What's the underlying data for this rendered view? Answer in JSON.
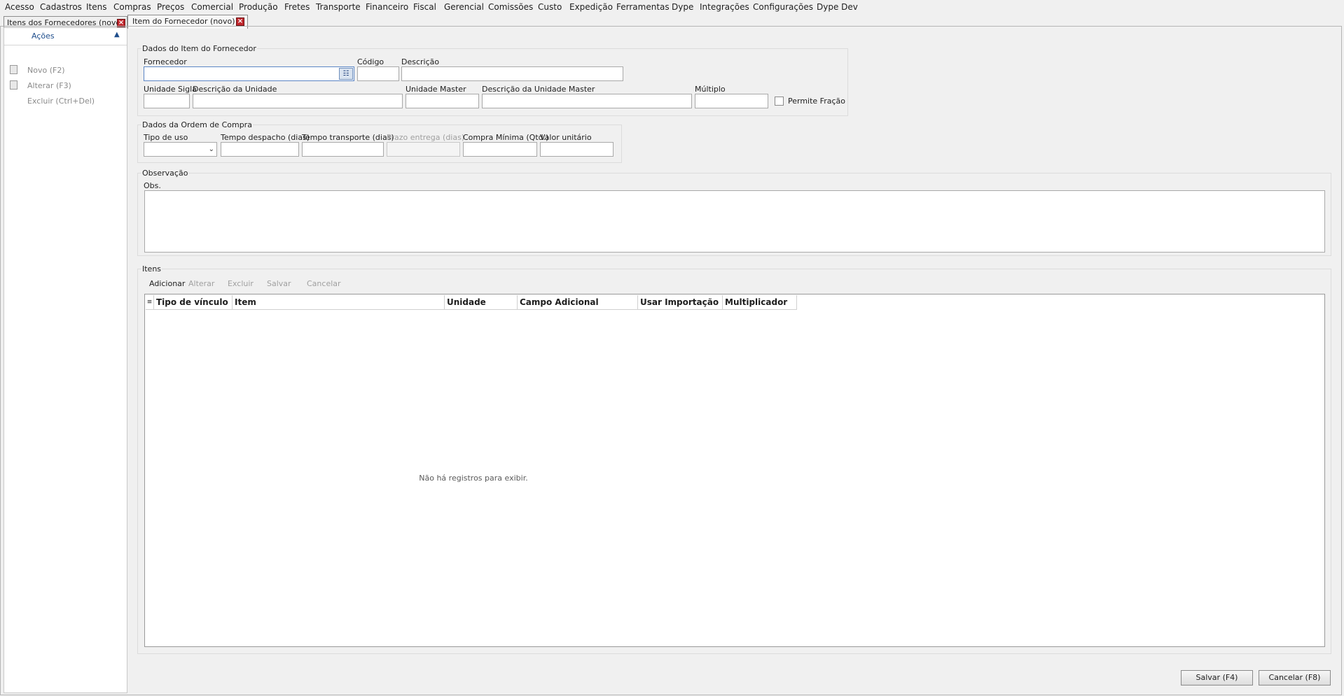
{
  "menu": [
    "Acesso",
    "Cadastros",
    "Itens",
    "Compras",
    "Preços",
    "Comercial",
    "Produção",
    "Fretes",
    "Transporte",
    "Financeiro",
    "Fiscal",
    "Gerencial",
    "Comissões",
    "Custo",
    "Expedição",
    "Ferramentas",
    "Dype",
    "Integrações",
    "Configurações",
    "Dype Dev"
  ],
  "tabs": [
    {
      "label": "Itens dos Fornecedores (novo)",
      "active": false
    },
    {
      "label": "Item do Fornecedor (novo) ()",
      "active": true
    }
  ],
  "left_panel": {
    "title": "Ações",
    "actions": [
      {
        "label": "Novo (F2)",
        "icon": "new-document-icon"
      },
      {
        "label": "Alterar (F3)",
        "icon": "edit-document-icon"
      },
      {
        "label": "Excluir (Ctrl+Del)",
        "icon": ""
      }
    ]
  },
  "dados_item": {
    "title": "Dados do Item do Fornecedor",
    "fornecedor_label": "Fornecedor",
    "codigo_label": "Código",
    "descricao_label": "Descrição",
    "unidade_sigla_label": "Unidade Sigla",
    "descricao_unidade_label": "Descrição da Unidade",
    "unidade_master_label": "Unidade Master",
    "descricao_unidade_master_label": "Descrição da Unidade Master",
    "multiplo_label": "Múltiplo",
    "permite_fracao_label": "Permite Fração",
    "permite_fracao_checked": false
  },
  "dados_ordem": {
    "title": "Dados da Ordem de Compra",
    "tipo_uso_label": "Tipo de uso",
    "tempo_despacho_label": "Tempo despacho (dias)",
    "tempo_transporte_label": "Tempo transporte (dias)",
    "prazo_entrega_label": "Prazo entrega (dias)",
    "compra_minima_label": "Compra Mínima (Qtd.)",
    "valor_unitario_label": "Valor unitário"
  },
  "observacao": {
    "title": "Observação",
    "obs_label": "Obs."
  },
  "itens": {
    "title": "Itens",
    "toolbar": [
      {
        "label": "Adicionar",
        "enabled": true
      },
      {
        "label": "Alterar",
        "enabled": false
      },
      {
        "label": "Excluir",
        "enabled": false
      },
      {
        "label": "Salvar",
        "enabled": false
      },
      {
        "label": "Cancelar",
        "enabled": false
      }
    ],
    "columns": [
      "Tipo de vínculo",
      "Item",
      "Unidade",
      "Campo Adicional",
      "Usar Importação",
      "Multiplicador"
    ],
    "empty_message": "Não há registros para exibir."
  },
  "footer": {
    "save_label": "Salvar (F4)",
    "cancel_label": "Cancelar (F8)"
  },
  "colors": {
    "accent": "#1f4e8c",
    "close_tab": "#c0272d"
  }
}
